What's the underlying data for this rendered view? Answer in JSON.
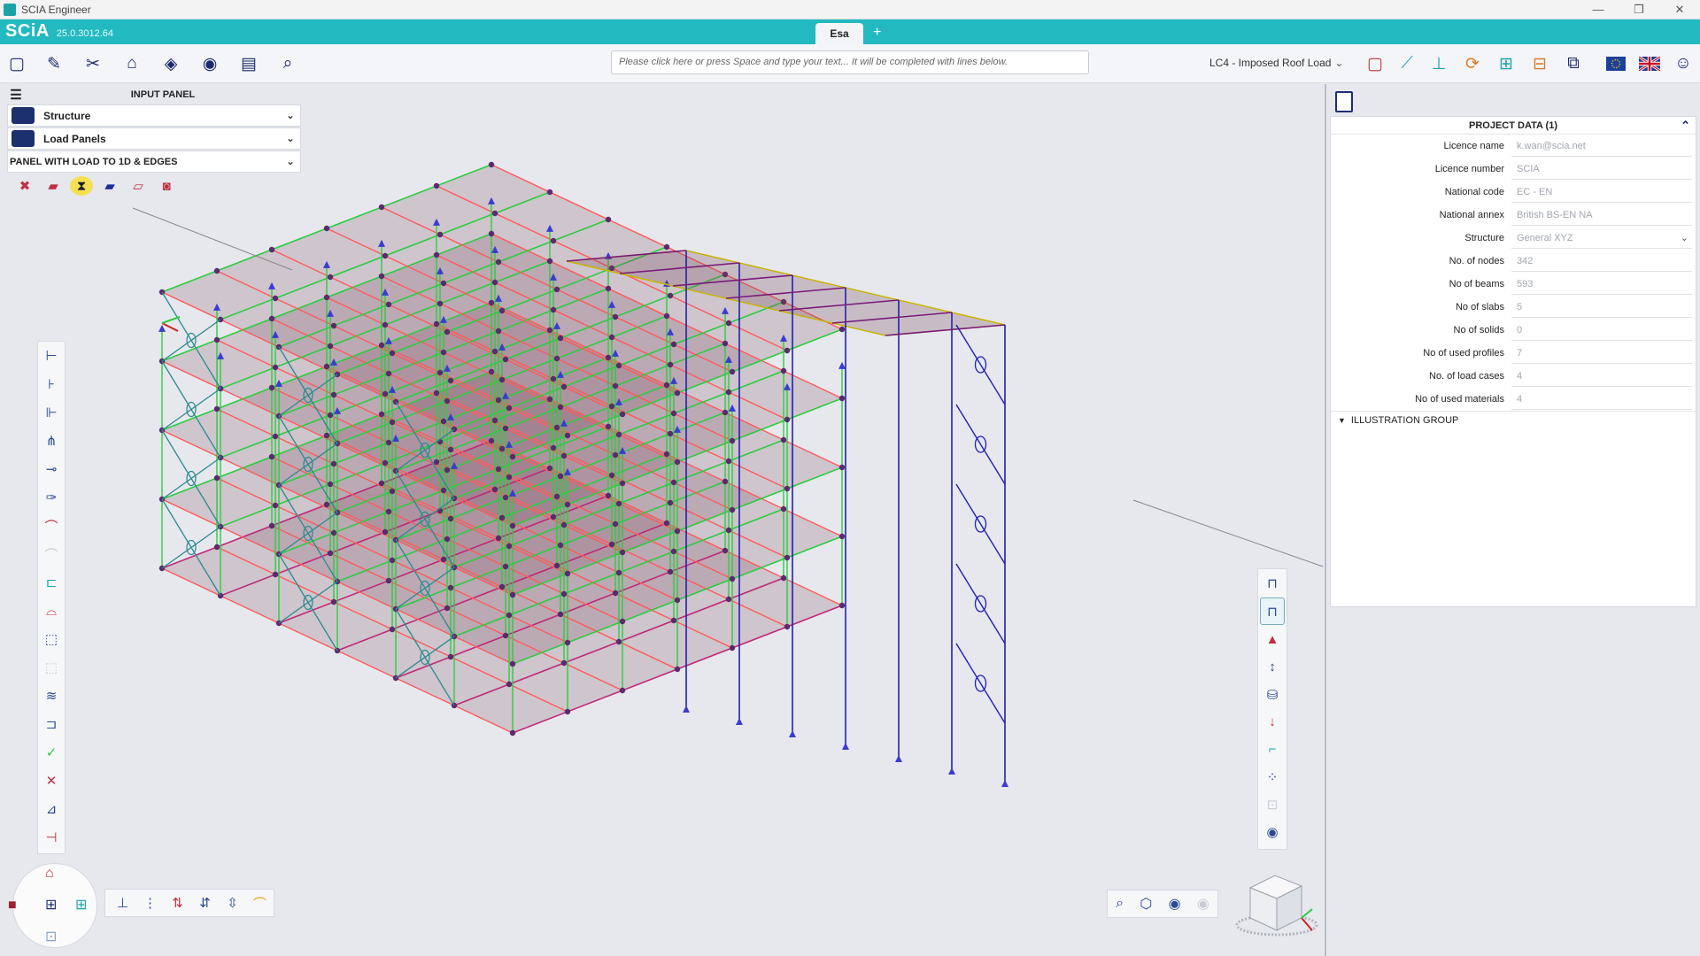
{
  "window": {
    "title": "SCIA Engineer",
    "controls": [
      "—",
      "❐",
      "✕"
    ]
  },
  "app": {
    "logo": "SCiA",
    "version": "25.0.3012.64",
    "document_tab": "Esa",
    "new_tab": "+"
  },
  "toolbar": {
    "command_placeholder": "Please click here or press Space and type your text... It will be completed with lines below.",
    "load_case": "LC4 - Imposed Roof Load",
    "left_icons": [
      "new-file-icon",
      "open-project-icon",
      "tools-icon",
      "structure-icon",
      "model-3d-icon",
      "view-icon",
      "library-icon",
      "search-help-icon"
    ],
    "right_icons": [
      "select-icon",
      "edit-icon",
      "measure-icon",
      "refresh-icon",
      "calculate-icon",
      "grid-icon",
      "layout-icon",
      "eu-flag-icon",
      "uk-flag-icon",
      "user-settings-icon"
    ]
  },
  "input_panel": {
    "title": "INPUT PANEL",
    "items": [
      {
        "label": "Structure",
        "icon": "structure-icon"
      },
      {
        "label": "Load Panels",
        "icon": "load-panels-icon"
      }
    ],
    "group": "PANEL WITH LOAD TO 1D & EDGES",
    "tools": [
      "panel-load-icon",
      "panel-solid-icon",
      "hourglass-icon",
      "panel-edge-icon",
      "panel-stripes-icon",
      "panel-opening-icon"
    ]
  },
  "project_data": {
    "title": "PROJECT DATA (1)",
    "rows": [
      {
        "label": "Licence name",
        "value": "k.wan@scia.net"
      },
      {
        "label": "Licence number",
        "value": "SCIA"
      },
      {
        "label": "National code",
        "value": "EC - EN"
      },
      {
        "label": "National annex",
        "value": "British BS-EN NA"
      },
      {
        "label": "Structure",
        "value": "General XYZ"
      },
      {
        "label": "No. of nodes",
        "value": "342"
      },
      {
        "label": "No of beams",
        "value": "593"
      },
      {
        "label": "No of slabs",
        "value": "5"
      },
      {
        "label": "No of solids",
        "value": "0"
      },
      {
        "label": "No of used profiles",
        "value": "7"
      },
      {
        "label": "No. of load cases",
        "value": "4"
      },
      {
        "label": "No of used materials",
        "value": "4"
      }
    ],
    "illustration_group": "ILLUSTRATION GROUP"
  },
  "colors": {
    "accent": "#22b9c0",
    "navy": "#1c2f6e",
    "column_green": "#2ecc40",
    "beam_red": "#ff5a5a",
    "brace_teal": "#2b8a8e",
    "frame_blue": "#2020b0",
    "slab_fill": "#7a4a5a"
  }
}
